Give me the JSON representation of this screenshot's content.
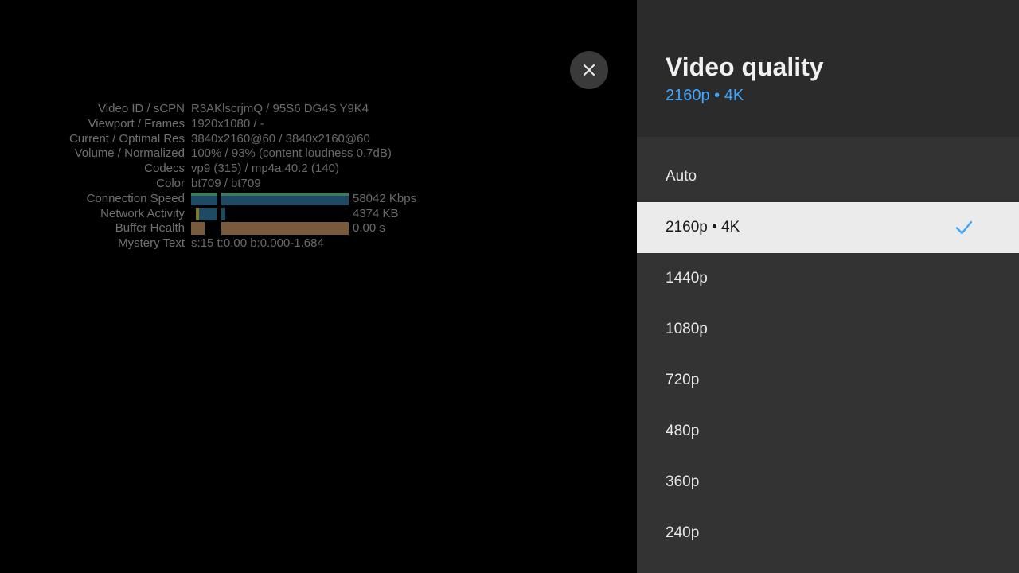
{
  "stats": {
    "rows": [
      {
        "label": "Video ID / sCPN",
        "value": "R3AKlscrjmQ / 95S6 DG4S Y9K4"
      },
      {
        "label": "Viewport / Frames",
        "value": "1920x1080 / -"
      },
      {
        "label": "Current / Optimal Res",
        "value": "3840x2160@60 / 3840x2160@60"
      },
      {
        "label": "Volume / Normalized",
        "value": "100% / 93% (content loudness 0.7dB)"
      },
      {
        "label": "Codecs",
        "value": "vp9 (315) / mp4a.40.2 (140)"
      },
      {
        "label": "Color",
        "value": "bt709 / bt709"
      }
    ],
    "connection_speed": {
      "label": "Connection Speed",
      "value": "58042 Kbps"
    },
    "network_activity": {
      "label": "Network Activity",
      "value": "4374 KB"
    },
    "buffer_health": {
      "label": "Buffer Health",
      "value": "0.00 s"
    },
    "mystery_text": {
      "label": "Mystery Text",
      "value": "s:15 t:0.00 b:0.000-1.684"
    }
  },
  "colors": {
    "accent": "#3ea6ff",
    "speed_bar_dark": "#1f4a63",
    "speed_bar_top": "#3f7a5a",
    "buffer_bar": "#7a5a3c"
  },
  "close_icon": "close-icon",
  "panel": {
    "title": "Video quality",
    "subtitle": "2160p • 4K",
    "options": [
      {
        "label": "Auto",
        "selected": false
      },
      {
        "label": "2160p • 4K",
        "selected": true
      },
      {
        "label": "1440p",
        "selected": false
      },
      {
        "label": "1080p",
        "selected": false
      },
      {
        "label": "720p",
        "selected": false
      },
      {
        "label": "480p",
        "selected": false
      },
      {
        "label": "360p",
        "selected": false
      },
      {
        "label": "240p",
        "selected": false
      }
    ]
  }
}
